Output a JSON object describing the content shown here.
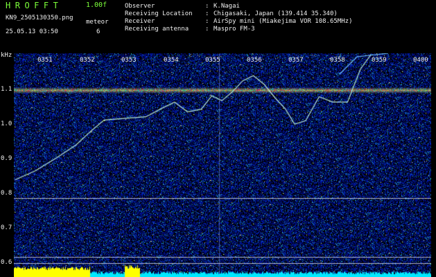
{
  "header": {
    "app_title": "HROFFT",
    "version": "1.00f",
    "filename": "KN9_2505130350.png",
    "meteor_label": "meteor",
    "datetime": "25.05.13 03:50",
    "meteor_count": "6"
  },
  "info": [
    {
      "key": "Observer",
      "value": "K.Nagai"
    },
    {
      "key": "Receiving Location",
      "value": "Chigasaki, Japan (139.414 35.340)"
    },
    {
      "key": "Receiver",
      "value": "AirSpy mini (Miakejima VOR 108.65MHz)"
    },
    {
      "key": "Receiving antenna",
      "value": "Maspro FM-3"
    }
  ],
  "axis": {
    "unit": "kHz",
    "y_ticks": [
      "1.1",
      "1.0",
      "0.9",
      "0.8",
      "0.7",
      "0.6"
    ],
    "x_ticks": [
      "0351",
      "0352",
      "0353",
      "0354",
      "0355",
      "0356",
      "0357",
      "0358",
      "0359",
      "0400"
    ]
  },
  "colors": {
    "background": "#000000",
    "title_green": "#7dff3a",
    "noise_low": "#0a1a8c",
    "carrier": "#e0e050",
    "echo_trace": "#b8e8d0",
    "bottom_bar_yellow": "#ffff00",
    "bottom_bar_cyan": "#00e8ff"
  }
}
